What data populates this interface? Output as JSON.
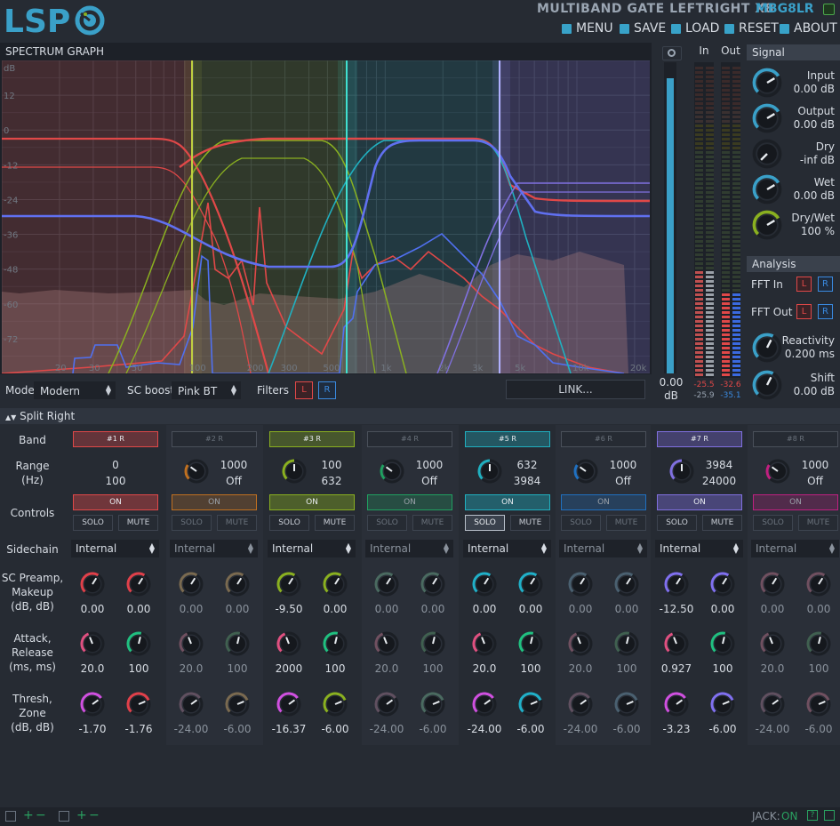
{
  "header": {
    "logo_text": "LSP",
    "plugin_title": "MULTIBAND GATE LEFTRIGHT X8",
    "plugin_id": "MBG8LR",
    "menu": [
      {
        "label": "MENU",
        "icon": "menu-icon"
      },
      {
        "label": "SAVE",
        "icon": "save-icon"
      },
      {
        "label": "LOAD",
        "icon": "load-icon"
      },
      {
        "label": "RESET",
        "icon": "reset-icon"
      },
      {
        "label": "ABOUT",
        "icon": "about-icon"
      }
    ]
  },
  "spectrum": {
    "title": "SPECTRUM GRAPH",
    "db_unit": "dB",
    "db_ticks": [
      "12",
      "0",
      "-12",
      "-24",
      "-36",
      "-48",
      "-60",
      "-72"
    ],
    "freq_ticks": [
      "20",
      "30",
      "50",
      "100",
      "200",
      "300",
      "500",
      "1k",
      "2k",
      "3k",
      "5k",
      "10k",
      "20k"
    ]
  },
  "controls_bar": {
    "mode_label": "Mode:",
    "mode_value": "Modern",
    "scboost_label": "SC boost:",
    "scboost_value": "Pink BT",
    "filters_label": "Filters",
    "filter_l": "L",
    "filter_r": "R",
    "link_label": "LINK..."
  },
  "meters": {
    "in_label": "In",
    "out_label": "Out",
    "gain_value": "0.00",
    "gain_unit": "dB",
    "in_l_peak": "-25.5",
    "in_r_peak": "-25.9",
    "out_l_peak": "-32.6",
    "out_r_peak": "-35.1",
    "in_level": 0.34,
    "out_level": 0.27,
    "gain_level": 0.95
  },
  "signal": {
    "title": "Signal",
    "knobs": [
      {
        "label": "Input",
        "value": "0.00 dB",
        "color": "#3aa0c8"
      },
      {
        "label": "Output",
        "value": "0.00 dB",
        "color": "#3aa0c8"
      },
      {
        "label": "Dry",
        "value": "-inf dB",
        "color": "#8a9a2a"
      },
      {
        "label": "Wet",
        "value": "0.00 dB",
        "color": "#3aa0c8"
      },
      {
        "label": "Dry/Wet",
        "value": "100 %",
        "color": "#8ab020"
      }
    ]
  },
  "analysis": {
    "title": "Analysis",
    "fft_in_label": "FFT In",
    "fft_out_label": "FFT Out",
    "l": "L",
    "r": "R",
    "knobs": [
      {
        "label": "Reactivity",
        "value": "0.200 ms",
        "color": "#3aa0c8"
      },
      {
        "label": "Shift",
        "value": "0.00 dB",
        "color": "#3aa0c8"
      }
    ]
  },
  "split_title": "Split Right",
  "row_labels": {
    "band": "Band",
    "range": "Range\n(Hz)",
    "controls": "Controls",
    "sidechain": "Sidechain",
    "preamp": "SC Preamp,\nMakeup\n(dB, dB)",
    "attack": "Attack,\nRelease\n(ms, ms)",
    "thresh": "Thresh,\nZone\n(dB, dB)"
  },
  "bands": [
    {
      "name": "#1 R",
      "active": true,
      "color": "#e04848",
      "range_top": "0",
      "range_bottom": "100",
      "has_range_knob": false,
      "on": "ON",
      "solo": "SOLO",
      "mute": "MUTE",
      "solo_on": false,
      "sidechain": "Internal",
      "preamp": "0.00",
      "makeup": "0.00",
      "attack": "20.0",
      "release": "100",
      "thresh": "-1.70",
      "zone": "-1.76",
      "k_preamp": "#e0404a",
      "k_makeup": "#e0404a",
      "k_attack": "#e05080",
      "k_release": "#20c080",
      "k_thresh": "#d050e0",
      "k_zone": "#e0404a"
    },
    {
      "name": "#2 R",
      "active": false,
      "color": "#c07020",
      "range_top": "1000",
      "range_bottom": "Off",
      "has_range_knob": true,
      "on": "ON",
      "solo": "SOLO",
      "mute": "MUTE",
      "solo_on": false,
      "sidechain": "Internal",
      "preamp": "0.00",
      "makeup": "0.00",
      "attack": "20.0",
      "release": "100",
      "thresh": "-24.00",
      "zone": "-6.00",
      "k_preamp": "#7a6a50",
      "k_makeup": "#7a6a50",
      "k_attack": "#705060",
      "k_release": "#406050",
      "k_thresh": "#605060",
      "k_zone": "#7a6a50"
    },
    {
      "name": "#3 R",
      "active": true,
      "color": "#8ab020",
      "range_top": "100",
      "range_bottom": "632",
      "has_range_knob": true,
      "on": "ON",
      "solo": "SOLO",
      "mute": "MUTE",
      "solo_on": false,
      "sidechain": "Internal",
      "preamp": "-9.50",
      "makeup": "0.00",
      "attack": "2000",
      "release": "100",
      "thresh": "-16.37",
      "zone": "-6.00",
      "k_preamp": "#8ab020",
      "k_makeup": "#8ab020",
      "k_attack": "#e05080",
      "k_release": "#20c080",
      "k_thresh": "#d050e0",
      "k_zone": "#8ab020"
    },
    {
      "name": "#4 R",
      "active": false,
      "color": "#20a060",
      "range_top": "1000",
      "range_bottom": "Off",
      "has_range_knob": true,
      "on": "ON",
      "solo": "SOLO",
      "mute": "MUTE",
      "solo_on": false,
      "sidechain": "Internal",
      "preamp": "0.00",
      "makeup": "0.00",
      "attack": "20.0",
      "release": "100",
      "thresh": "-24.00",
      "zone": "-6.00",
      "k_preamp": "#4a6a60",
      "k_makeup": "#4a6a60",
      "k_attack": "#705060",
      "k_release": "#406050",
      "k_thresh": "#605060",
      "k_zone": "#4a6a60"
    },
    {
      "name": "#5 R",
      "active": true,
      "color": "#20b0c0",
      "range_top": "632",
      "range_bottom": "3984",
      "has_range_knob": true,
      "on": "ON",
      "solo": "SOLO",
      "mute": "MUTE",
      "solo_on": true,
      "sidechain": "Internal",
      "preamp": "0.00",
      "makeup": "0.00",
      "attack": "20.0",
      "release": "100",
      "thresh": "-24.00",
      "zone": "-6.00",
      "k_preamp": "#20b0c8",
      "k_makeup": "#20b0c8",
      "k_attack": "#e05080",
      "k_release": "#20c080",
      "k_thresh": "#d050e0",
      "k_zone": "#20b0c8"
    },
    {
      "name": "#6 R",
      "active": false,
      "color": "#2070c0",
      "range_top": "1000",
      "range_bottom": "Off",
      "has_range_knob": true,
      "on": "ON",
      "solo": "SOLO",
      "mute": "MUTE",
      "solo_on": false,
      "sidechain": "Internal",
      "preamp": "0.00",
      "makeup": "0.00",
      "attack": "20.0",
      "release": "100",
      "thresh": "-24.00",
      "zone": "-6.00",
      "k_preamp": "#4a6070",
      "k_makeup": "#4a6070",
      "k_attack": "#705060",
      "k_release": "#406050",
      "k_thresh": "#605060",
      "k_zone": "#4a6070"
    },
    {
      "name": "#7 R",
      "active": true,
      "color": "#8070e0",
      "range_top": "3984",
      "range_bottom": "24000",
      "has_range_knob": true,
      "on": "ON",
      "solo": "SOLO",
      "mute": "MUTE",
      "solo_on": false,
      "sidechain": "Internal",
      "preamp": "-12.50",
      "makeup": "0.00",
      "attack": "0.927",
      "release": "100",
      "thresh": "-3.23",
      "zone": "-6.00",
      "k_preamp": "#8070f0",
      "k_makeup": "#8070f0",
      "k_attack": "#e05080",
      "k_release": "#20c080",
      "k_thresh": "#d050e0",
      "k_zone": "#8070f0"
    },
    {
      "name": "#8 R",
      "active": false,
      "color": "#c02080",
      "range_top": "1000",
      "range_bottom": "Off",
      "has_range_knob": true,
      "on": "ON",
      "solo": "SOLO",
      "mute": "MUTE",
      "solo_on": false,
      "sidechain": "Internal",
      "preamp": "0.00",
      "makeup": "0.00",
      "attack": "20.0",
      "release": "100",
      "thresh": "-24.00",
      "zone": "-6.00",
      "k_preamp": "#705060",
      "k_makeup": "#705060",
      "k_attack": "#705060",
      "k_release": "#406050",
      "k_thresh": "#605060",
      "k_zone": "#705060"
    }
  ],
  "status": {
    "jack_label": "JACK:",
    "jack_value": "ON"
  }
}
